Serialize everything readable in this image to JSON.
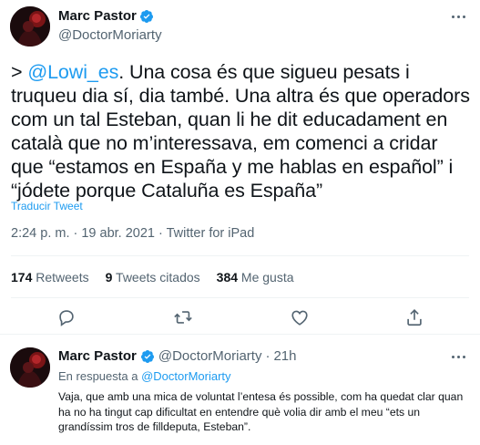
{
  "colors": {
    "accent": "#1d9bf0",
    "secondary_text": "#536471",
    "text": "#0f1419",
    "divider": "#eff3f4"
  },
  "main_tweet": {
    "author_name": "Marc Pastor",
    "author_handle": "@DoctorMoriarty",
    "verified_icon": "verified-badge-icon",
    "text_prefix": "> ",
    "mention": "@Lowi_es",
    "text": ". Una cosa és que sigueu pesats i truqueu dia sí, dia també. Una altra és que operadors com un tal Esteban, quan li he dit educadament en català que no m’interessava, em comenci a cridar que “estamos en España y me hablas en español” i “jódete porque Cataluña es España”",
    "translate_label": "Traducir Tweet",
    "timestamp": "2:24 p. m. · 19 abr. 2021 · Twitter for iPad",
    "stats": {
      "retweets_count": "174",
      "retweets_label": "Retweets",
      "quotes_count": "9",
      "quotes_label": "Tweets citados",
      "likes_count": "384",
      "likes_label": "Me gusta"
    },
    "actions": [
      "reply-icon",
      "retweet-icon",
      "like-icon",
      "share-icon"
    ]
  },
  "reply_tweet": {
    "author_name": "Marc Pastor",
    "author_handle": "@DoctorMoriarty",
    "separator": "·",
    "time": "21h",
    "replying_prefix": "En respuesta a",
    "replying_mention": "@DoctorMoriarty",
    "text": "Vaja, que amb una mica de voluntat l’entesa és possible, com ha quedat clar quan ha no ha tingut cap dificultat en entendre què volia dir amb el meu “ets un grandíssim tros de filldeputa, Esteban”."
  }
}
